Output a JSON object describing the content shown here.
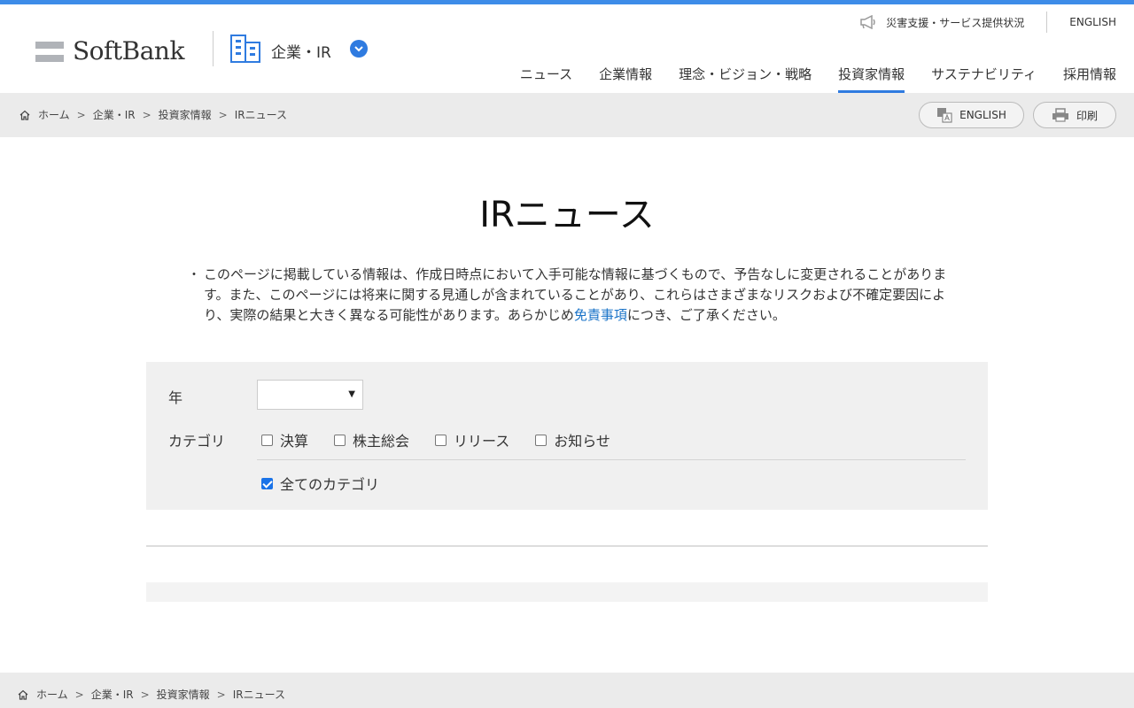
{
  "colors": {
    "accent": "#3d8ce8",
    "link": "#1a73c8",
    "band": "#ebebeb"
  },
  "header": {
    "logo_text": "SoftBank",
    "section_title": "企業・IR",
    "util_links": [
      {
        "icon": "megaphone-icon",
        "label": "災害支援・サービス提供状況"
      },
      {
        "label": "ENGLISH"
      }
    ],
    "nav": [
      {
        "label": "ニュース",
        "active": false
      },
      {
        "label": "企業情報",
        "active": false
      },
      {
        "label": "理念・ビジョン・戦略",
        "active": false
      },
      {
        "label": "投資家情報",
        "active": true
      },
      {
        "label": "サステナビリティ",
        "active": false
      },
      {
        "label": "採用情報",
        "active": false
      }
    ]
  },
  "breadcrumb": [
    {
      "icon": "home-icon",
      "label": "ホーム"
    },
    {
      "label": "企業・IR"
    },
    {
      "label": "投資家情報"
    },
    {
      "label": "IRニュース"
    }
  ],
  "breadcrumb_sep": ">",
  "actions": {
    "english_label": "ENGLISH",
    "print_label": "印刷"
  },
  "main": {
    "title": "IRニュース",
    "notice_bullet": "・",
    "notice_before": "このページに掲載している情報は、作成日時点において入手可能な情報に基づくもので、予告なしに変更されることがあります。また、このページには将来に関する見通しが含まれていることがあり、これらはさまざまなリスクおよび不確定要因により、実際の結果と大きく異なる可能性があります。あらかじめ",
    "notice_link": "免責事項",
    "notice_after": "につき、ご了承ください。"
  },
  "filter": {
    "year_label": "年",
    "year_value": "",
    "category_label": "カテゴリ",
    "categories": [
      {
        "label": "決算",
        "checked": false
      },
      {
        "label": "株主総会",
        "checked": false
      },
      {
        "label": "リリース",
        "checked": false
      },
      {
        "label": "お知らせ",
        "checked": false
      }
    ],
    "all_label": "全てのカテゴリ",
    "all_checked": true
  }
}
